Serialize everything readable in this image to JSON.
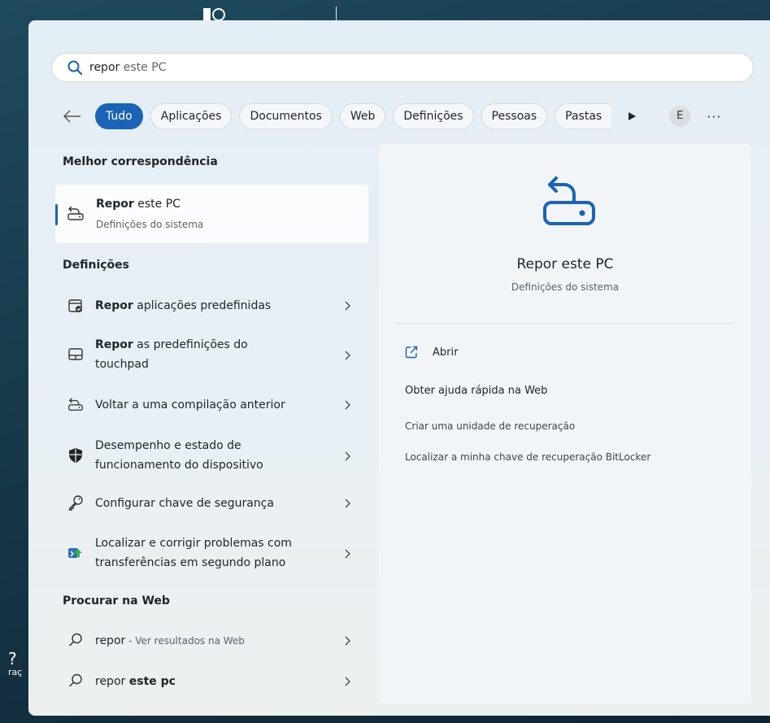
{
  "desktop": {
    "label_fragment": "raç"
  },
  "search": {
    "typed": "repor",
    "rest": " este PC"
  },
  "filters": {
    "tabs": [
      "Tudo",
      "Aplicações",
      "Documentos",
      "Web",
      "Definições",
      "Pessoas",
      "Pastas"
    ],
    "avatar_letter": "E",
    "more": "···"
  },
  "best_match": {
    "heading": "Melhor correspondência",
    "title_bold": "Repor",
    "title_rest": " este PC",
    "subtitle": "Definições do sistema"
  },
  "settings": {
    "heading": "Definições",
    "items": [
      {
        "bold": "Repor",
        "rest": " aplicações predefinidas",
        "icon": "default-apps-icon"
      },
      {
        "bold": "Repor",
        "rest": " as predefinições do touchpad",
        "icon": "touchpad-icon"
      },
      {
        "bold": "",
        "rest": "Voltar a uma compilação anterior",
        "icon": "recovery-icon"
      },
      {
        "bold": "",
        "rest": "Desempenho e estado de funcionamento do dispositivo",
        "icon": "shield-icon"
      },
      {
        "bold": "",
        "rest": "Configurar chave de segurança",
        "icon": "key-icon"
      },
      {
        "bold": "",
        "rest": "Localizar e corrigir problemas com transferências em segundo plano",
        "icon": "transfer-icon"
      }
    ]
  },
  "web": {
    "heading": "Procurar na Web",
    "items": [
      {
        "bold": "repor",
        "rest": "",
        "suffix": " - Ver resultados na Web"
      },
      {
        "bold": "",
        "rest": "repor ",
        "bold2": "este pc"
      }
    ]
  },
  "preview": {
    "title": "Repor este PC",
    "subtitle": "Definições do sistema",
    "open": "Abrir",
    "web_help": "Obter ajuda rápida na Web",
    "links": [
      "Criar uma unidade de recuperação",
      "Localizar a minha chave de recuperação BitLocker"
    ]
  },
  "colors": {
    "accent": "#1a63b6"
  }
}
